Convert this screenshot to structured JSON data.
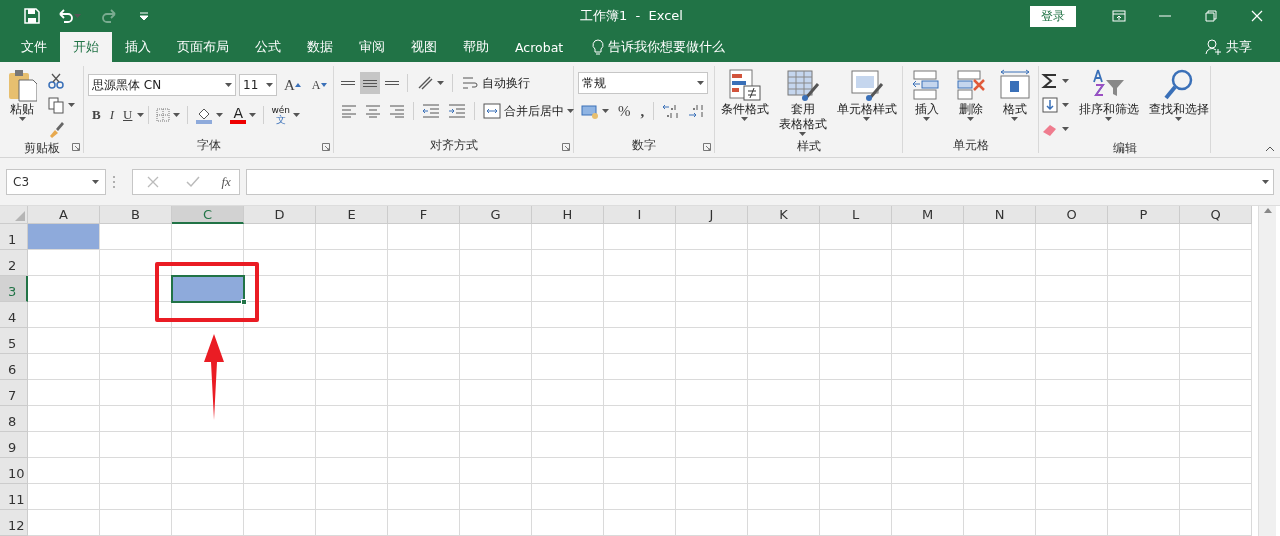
{
  "window": {
    "title": "工作簿1  -  Excel",
    "login": "登录"
  },
  "tabs": [
    {
      "label": "文件",
      "selected": false
    },
    {
      "label": "开始",
      "selected": true
    },
    {
      "label": "插入",
      "selected": false
    },
    {
      "label": "页面布局",
      "selected": false
    },
    {
      "label": "公式",
      "selected": false
    },
    {
      "label": "数据",
      "selected": false
    },
    {
      "label": "审阅",
      "selected": false
    },
    {
      "label": "视图",
      "selected": false
    },
    {
      "label": "帮助",
      "selected": false
    },
    {
      "label": "Acrobat",
      "selected": false
    }
  ],
  "tell_me": "告诉我你想要做什么",
  "share": "共享",
  "ribbon": [
    {
      "kind": "clipboard",
      "label": "剪贴板",
      "launcher": true,
      "paste": "粘贴"
    },
    {
      "kind": "font",
      "label": "字体",
      "launcher": true,
      "font_name": "思源黑体 CN",
      "font_size": "11",
      "grow": "A",
      "shrink": "A",
      "styles": [
        "B",
        "I",
        "U"
      ],
      "color_glyph": "A",
      "phonetic_top": "wén",
      "phonetic_bottom": "文"
    },
    {
      "kind": "alignment",
      "label": "对齐方式",
      "launcher": true,
      "vertical": [
        {
          "selected": false
        },
        {
          "selected": true
        },
        {
          "selected": false
        }
      ],
      "wrap": "自动换行",
      "merge": "合并后居中"
    },
    {
      "kind": "number",
      "label": "数字",
      "launcher": true,
      "format": "常规",
      "percent": "%",
      "comma": ","
    },
    {
      "kind": "styles",
      "label": "样式",
      "buttons": [
        {
          "lines": [
            "条件格式"
          ]
        },
        {
          "lines": [
            "套用",
            "表格格式"
          ]
        },
        {
          "lines": [
            "单元格样式"
          ]
        }
      ]
    },
    {
      "kind": "cells",
      "label": "单元格",
      "buttons": [
        {
          "lines": [
            "插入"
          ]
        },
        {
          "lines": [
            "删除"
          ]
        },
        {
          "lines": [
            "格式"
          ]
        }
      ]
    },
    {
      "kind": "editing",
      "label": "编辑",
      "buttons": [
        {
          "lines": [
            "排序和筛选"
          ]
        },
        {
          "lines": [
            "查找和选择"
          ]
        }
      ]
    }
  ],
  "formula_bar": {
    "name_box": "C3",
    "fx": "fx"
  },
  "sheet": {
    "columns": [
      {
        "label": "A",
        "selected": false
      },
      {
        "label": "B",
        "selected": false
      },
      {
        "label": "C",
        "selected": true
      },
      {
        "label": "D",
        "selected": false
      },
      {
        "label": "E",
        "selected": false
      },
      {
        "label": "F",
        "selected": false
      },
      {
        "label": "G",
        "selected": false
      },
      {
        "label": "H",
        "selected": false
      },
      {
        "label": "I",
        "selected": false
      },
      {
        "label": "J",
        "selected": false
      },
      {
        "label": "K",
        "selected": false
      },
      {
        "label": "L",
        "selected": false
      },
      {
        "label": "M",
        "selected": false
      },
      {
        "label": "N",
        "selected": false
      },
      {
        "label": "O",
        "selected": false
      },
      {
        "label": "P",
        "selected": false
      },
      {
        "label": "Q",
        "selected": false
      }
    ],
    "rows": [
      {
        "label": "1",
        "selected": false,
        "filled": [
          true,
          false,
          false,
          false,
          false,
          false,
          false,
          false,
          false,
          false,
          false,
          false,
          false,
          false,
          false,
          false,
          false
        ]
      },
      {
        "label": "2",
        "selected": false,
        "filled": [
          false,
          false,
          false,
          false,
          false,
          false,
          false,
          false,
          false,
          false,
          false,
          false,
          false,
          false,
          false,
          false,
          false
        ]
      },
      {
        "label": "3",
        "selected": true,
        "filled": [
          false,
          false,
          true,
          false,
          false,
          false,
          false,
          false,
          false,
          false,
          false,
          false,
          false,
          false,
          false,
          false,
          false
        ]
      },
      {
        "label": "4",
        "selected": false,
        "filled": [
          false,
          false,
          false,
          false,
          false,
          false,
          false,
          false,
          false,
          false,
          false,
          false,
          false,
          false,
          false,
          false,
          false
        ]
      },
      {
        "label": "5",
        "selected": false,
        "filled": [
          false,
          false,
          false,
          false,
          false,
          false,
          false,
          false,
          false,
          false,
          false,
          false,
          false,
          false,
          false,
          false,
          false
        ]
      },
      {
        "label": "6",
        "selected": false,
        "filled": [
          false,
          false,
          false,
          false,
          false,
          false,
          false,
          false,
          false,
          false,
          false,
          false,
          false,
          false,
          false,
          false,
          false
        ]
      },
      {
        "label": "7",
        "selected": false,
        "filled": [
          false,
          false,
          false,
          false,
          false,
          false,
          false,
          false,
          false,
          false,
          false,
          false,
          false,
          false,
          false,
          false,
          false
        ]
      },
      {
        "label": "8",
        "selected": false,
        "filled": [
          false,
          false,
          false,
          false,
          false,
          false,
          false,
          false,
          false,
          false,
          false,
          false,
          false,
          false,
          false,
          false,
          false
        ]
      },
      {
        "label": "9",
        "selected": false,
        "filled": [
          false,
          false,
          false,
          false,
          false,
          false,
          false,
          false,
          false,
          false,
          false,
          false,
          false,
          false,
          false,
          false,
          false
        ]
      },
      {
        "label": "10",
        "selected": false,
        "filled": [
          false,
          false,
          false,
          false,
          false,
          false,
          false,
          false,
          false,
          false,
          false,
          false,
          false,
          false,
          false,
          false,
          false
        ]
      },
      {
        "label": "11",
        "selected": false,
        "filled": [
          false,
          false,
          false,
          false,
          false,
          false,
          false,
          false,
          false,
          false,
          false,
          false,
          false,
          false,
          false,
          false,
          false
        ]
      },
      {
        "label": "12",
        "selected": false,
        "filled": [
          false,
          false,
          false,
          false,
          false,
          false,
          false,
          false,
          false,
          false,
          false,
          false,
          false,
          false,
          false,
          false,
          false
        ]
      }
    ]
  },
  "annotation": {
    "box": true,
    "arrow": true
  }
}
